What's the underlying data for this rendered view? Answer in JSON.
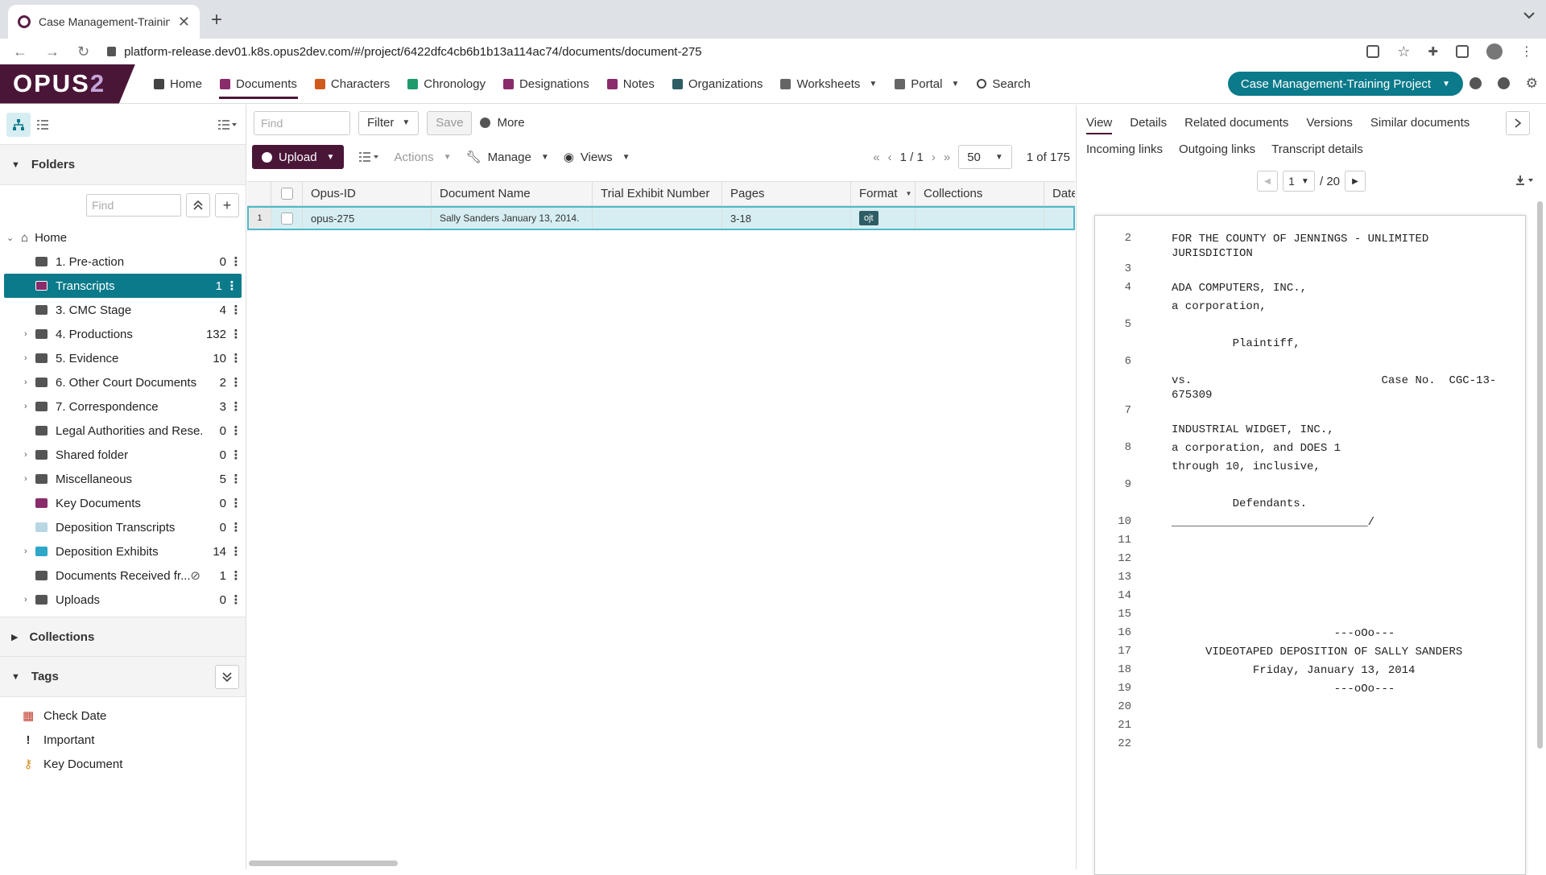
{
  "browser": {
    "tab_title": "Case Management-Training Pr",
    "url": "platform-release.dev01.k8s.opus2dev.com/#/project/6422dfc4cb6b1b13a114ac74/documents/document-275"
  },
  "app": {
    "logo": "OPUS",
    "logo_num": "2",
    "nav": [
      {
        "label": "Home",
        "icon": "home-icon"
      },
      {
        "label": "Documents",
        "icon": "documents-icon"
      },
      {
        "label": "Characters",
        "icon": "characters-icon"
      },
      {
        "label": "Chronology",
        "icon": "chronology-icon"
      },
      {
        "label": "Designations",
        "icon": "designations-icon"
      },
      {
        "label": "Notes",
        "icon": "notes-icon"
      },
      {
        "label": "Organizations",
        "icon": "organizations-icon"
      },
      {
        "label": "Worksheets",
        "icon": "worksheets-icon"
      },
      {
        "label": "Portal",
        "icon": "portal-icon"
      },
      {
        "label": "Search",
        "icon": "search-icon"
      }
    ],
    "project": "Case Management-Training Project",
    "colors": {
      "brand": "#4a1637",
      "accent": "#0b7a8a"
    }
  },
  "left": {
    "folders_title": "Folders",
    "find_placeholder": "Find",
    "home_label": "Home",
    "folders": [
      {
        "label": "1. Pre-action",
        "count": "0",
        "exp": "",
        "color": "#555555"
      },
      {
        "label": "Transcripts",
        "count": "1",
        "exp": "",
        "color": "#8a2c6b"
      },
      {
        "label": "3. CMC Stage",
        "count": "4",
        "exp": "",
        "color": "#555555"
      },
      {
        "label": "4. Productions",
        "count": "132",
        "exp": "›",
        "color": "#555555"
      },
      {
        "label": "5. Evidence",
        "count": "10",
        "exp": "›",
        "color": "#555555"
      },
      {
        "label": "6. Other Court Documents",
        "count": "2",
        "exp": "›",
        "color": "#555555"
      },
      {
        "label": "7. Correspondence",
        "count": "3",
        "exp": "›",
        "color": "#555555"
      },
      {
        "label": "Legal Authorities and Rese...",
        "count": "0",
        "exp": "",
        "color": "#555555"
      },
      {
        "label": "Shared folder",
        "count": "0",
        "exp": "›",
        "color": "#555555"
      },
      {
        "label": "Miscellaneous",
        "count": "5",
        "exp": "›",
        "color": "#555555"
      },
      {
        "label": "Key Documents",
        "count": "0",
        "exp": "",
        "color": "#8a2c6b"
      },
      {
        "label": "Deposition Transcripts",
        "count": "0",
        "exp": "",
        "color": "#b9d7e3"
      },
      {
        "label": "Deposition Exhibits",
        "count": "14",
        "exp": "›",
        "color": "#2ea7c9"
      },
      {
        "label": "Documents Received fr...",
        "count": "1",
        "exp": "",
        "color": "#555555"
      },
      {
        "label": "Uploads",
        "count": "0",
        "exp": "›",
        "color": "#555555"
      }
    ],
    "collections_title": "Collections",
    "tags_title": "Tags",
    "tags": [
      {
        "label": "Check Date",
        "icon": "calendar-icon",
        "glyph": "▦",
        "color": "#c0392b"
      },
      {
        "label": "Important",
        "icon": "exclamation-icon",
        "glyph": "!",
        "color": "#333333"
      },
      {
        "label": "Key Document",
        "icon": "key-icon",
        "glyph": "⚷",
        "color": "#d08a1a"
      }
    ]
  },
  "center": {
    "find_placeholder": "Find",
    "filter": "Filter",
    "save": "Save",
    "more": "More",
    "upload": "Upload",
    "actions": "Actions",
    "manage": "Manage",
    "views": "Views",
    "page": "1 / 1",
    "per_page": "50",
    "total": "1 of 175",
    "columns": [
      "Opus-ID",
      "Document Name",
      "Trial Exhibit Number",
      "Pages",
      "Format",
      "Collections",
      "Date"
    ],
    "row": {
      "index": "1",
      "opus_id": "opus-275",
      "doc_name": "Sally Sanders January 13, 2014.",
      "trial_exhibit": "",
      "pages": "3-18",
      "format": "ojt",
      "collections": "",
      "date": ""
    }
  },
  "right": {
    "tabs1": [
      "View",
      "Details",
      "Related documents",
      "Versions",
      "Similar documents"
    ],
    "tabs2": [
      "Incoming links",
      "Outgoing links",
      "Transcript details"
    ],
    "page_current": "1",
    "page_total": "/ 20",
    "transcript": [
      {
        "n": "2",
        "t": "FOR THE COUNTY OF JENNINGS - UNLIMITED\nJURISDICTION"
      },
      {
        "n": "3",
        "t": ""
      },
      {
        "n": "4",
        "t": "ADA COMPUTERS, INC.,"
      },
      {
        "n": "",
        "t": "a corporation,"
      },
      {
        "n": "5",
        "t": ""
      },
      {
        "n": "",
        "t": "         Plaintiff,"
      },
      {
        "n": "6",
        "t": ""
      },
      {
        "n": "",
        "t": "vs.                            Case No.  CGC-13-\n675309"
      },
      {
        "n": "7",
        "t": ""
      },
      {
        "n": "",
        "t": "INDUSTRIAL WIDGET, INC.,"
      },
      {
        "n": "8",
        "t": "a corporation, and DOES 1"
      },
      {
        "n": "",
        "t": "through 10, inclusive,"
      },
      {
        "n": "9",
        "t": ""
      },
      {
        "n": "",
        "t": "         Defendants."
      },
      {
        "n": "10",
        "t": "_____________________________/"
      },
      {
        "n": "11",
        "t": ""
      },
      {
        "n": "12",
        "t": ""
      },
      {
        "n": "13",
        "t": ""
      },
      {
        "n": "14",
        "t": ""
      },
      {
        "n": "15",
        "t": ""
      },
      {
        "n": "16",
        "t": "                        ---oOo---"
      },
      {
        "n": "17",
        "t": "     VIDEOTAPED DEPOSITION OF SALLY SANDERS"
      },
      {
        "n": "18",
        "t": "            Friday, January 13, 2014"
      },
      {
        "n": "19",
        "t": "                        ---oOo---"
      },
      {
        "n": "20",
        "t": ""
      },
      {
        "n": "21",
        "t": ""
      },
      {
        "n": "22",
        "t": ""
      }
    ]
  }
}
